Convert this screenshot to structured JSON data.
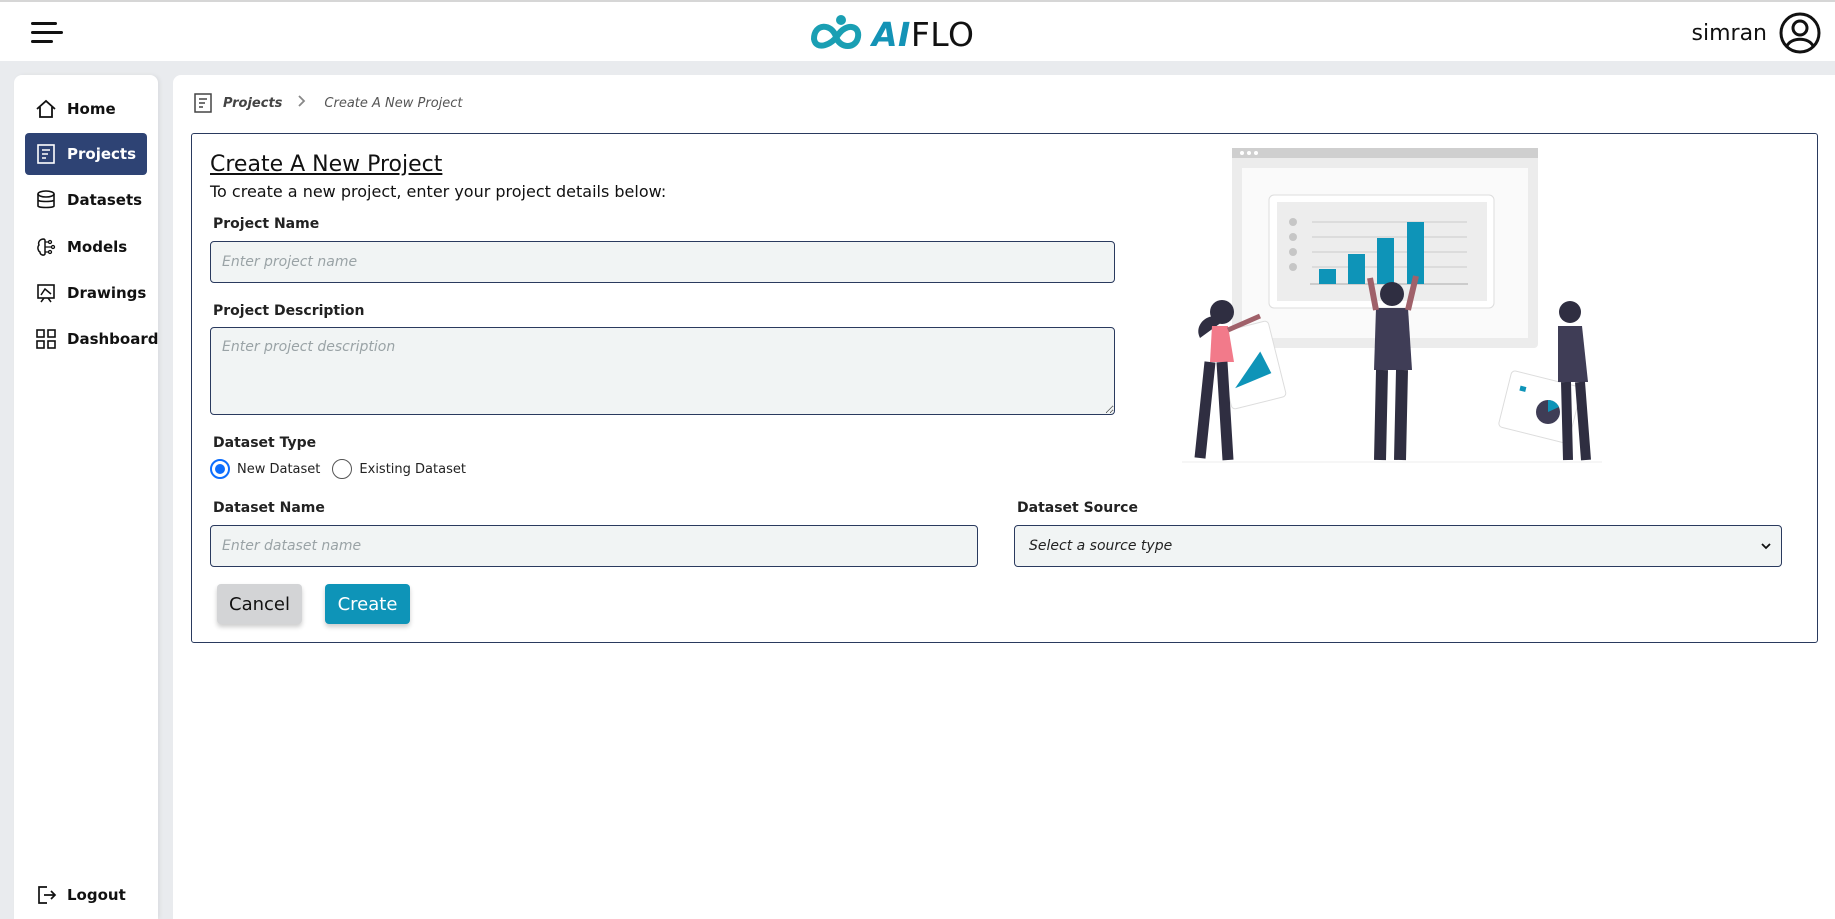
{
  "header": {
    "logo_ai": "AI",
    "logo_flo": "FLO",
    "username": "simran"
  },
  "sidebar": {
    "items": [
      {
        "label": "Home",
        "icon": "home-icon"
      },
      {
        "label": "Projects",
        "icon": "projects-icon",
        "active": true
      },
      {
        "label": "Datasets",
        "icon": "database-icon"
      },
      {
        "label": "Models",
        "icon": "brain-icon"
      },
      {
        "label": "Drawings",
        "icon": "drawing-icon"
      },
      {
        "label": "Dashboard",
        "icon": "dashboard-grid-icon"
      }
    ],
    "logout": "Logout"
  },
  "breadcrumb": {
    "root": "Projects",
    "current": "Create A New Project"
  },
  "form": {
    "title": "Create A New Project",
    "subtitle": "To create a new project, enter your project details below:",
    "project_name_label": "Project Name",
    "project_name_placeholder": "Enter project name",
    "project_description_label": "Project Description",
    "project_description_placeholder": "Enter project description",
    "dataset_type_label": "Dataset Type",
    "dataset_type_options": [
      "New Dataset",
      "Existing Dataset"
    ],
    "dataset_type_selected": "New Dataset",
    "dataset_name_label": "Dataset Name",
    "dataset_name_placeholder": "Enter dataset name",
    "dataset_source_label": "Dataset Source",
    "dataset_source_selected": "Select a source type",
    "cancel_label": "Cancel",
    "create_label": "Create"
  },
  "colors": {
    "accent": "#0e94b8",
    "sidebar_active": "#2e4374",
    "border": "#2a3a5e",
    "illustration_pink": "#f27a8a"
  }
}
